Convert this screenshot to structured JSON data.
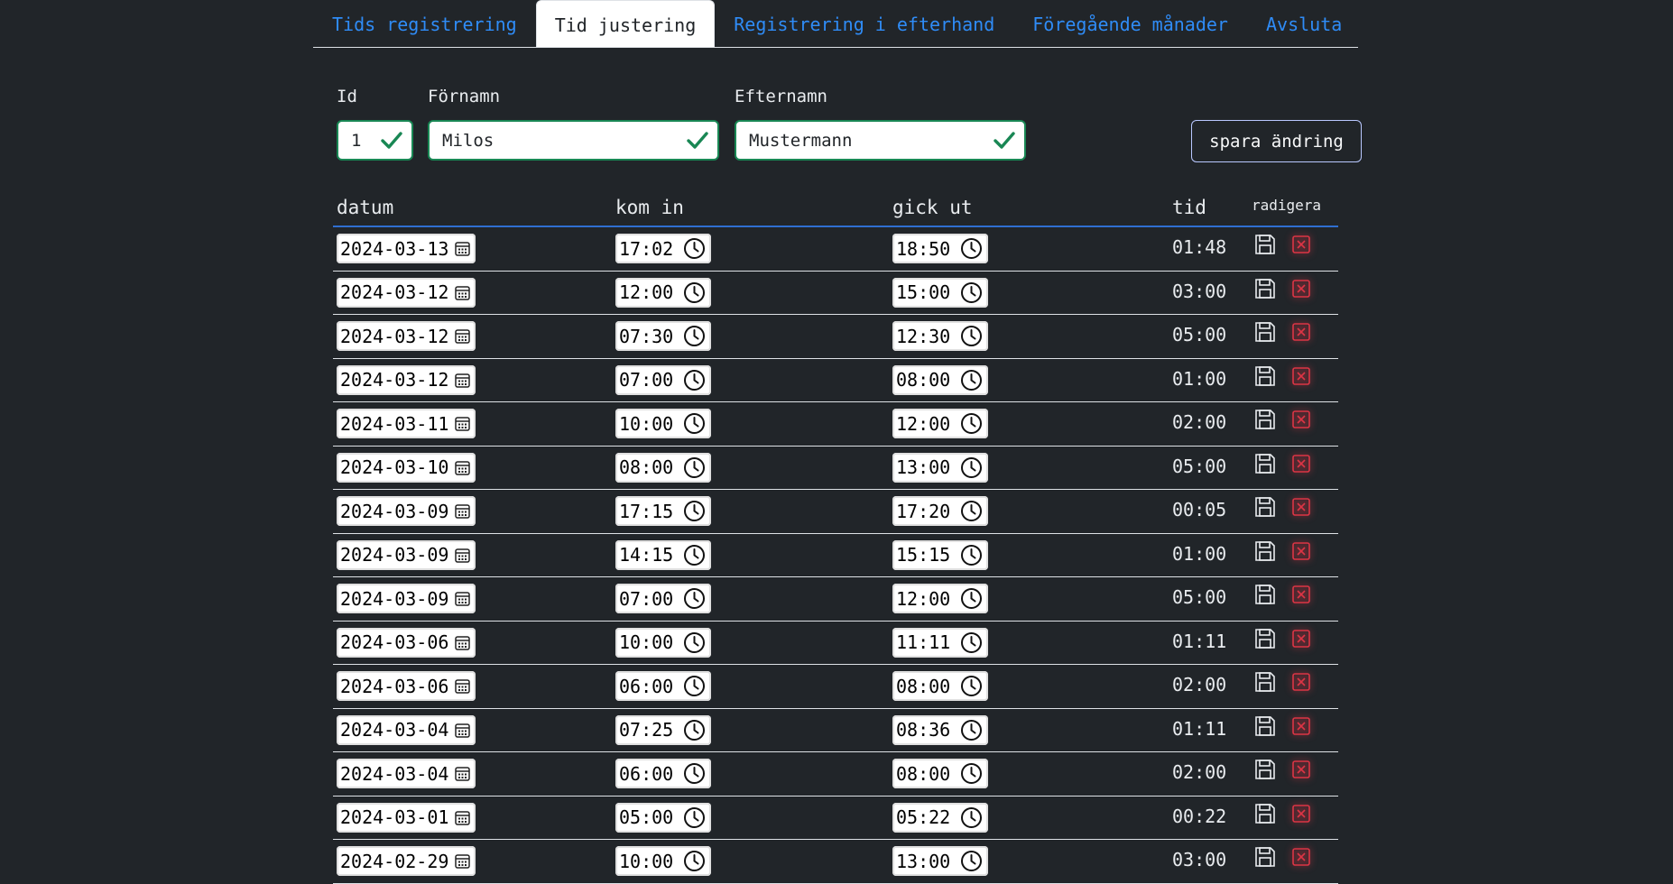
{
  "tabs": [
    {
      "label": "Tids registrering",
      "active": false
    },
    {
      "label": "Tid justering",
      "active": true
    },
    {
      "label": "Registrering i efterhand",
      "active": false
    },
    {
      "label": "Föregående månader",
      "active": false
    },
    {
      "label": "Avsluta",
      "active": false
    }
  ],
  "form": {
    "id_label": "Id",
    "id_value": "1",
    "firstname_label": "Förnamn",
    "firstname_value": "Milos",
    "lastname_label": "Efternamn",
    "lastname_value": "Mustermann",
    "save_label": "spara ändring"
  },
  "table": {
    "headers": {
      "date": "datum",
      "in": "kom in",
      "out": "gick ut",
      "time": "tid",
      "edit": "radigera"
    },
    "rows": [
      {
        "date": "2024-03-13",
        "in": "17:02",
        "out": "18:50",
        "time": "01:48"
      },
      {
        "date": "2024-03-12",
        "in": "12:00",
        "out": "15:00",
        "time": "03:00"
      },
      {
        "date": "2024-03-12",
        "in": "07:30",
        "out": "12:30",
        "time": "05:00"
      },
      {
        "date": "2024-03-12",
        "in": "07:00",
        "out": "08:00",
        "time": "01:00"
      },
      {
        "date": "2024-03-11",
        "in": "10:00",
        "out": "12:00",
        "time": "02:00"
      },
      {
        "date": "2024-03-10",
        "in": "08:00",
        "out": "13:00",
        "time": "05:00"
      },
      {
        "date": "2024-03-09",
        "in": "17:15",
        "out": "17:20",
        "time": "00:05"
      },
      {
        "date": "2024-03-09",
        "in": "14:15",
        "out": "15:15",
        "time": "01:00"
      },
      {
        "date": "2024-03-09",
        "in": "07:00",
        "out": "12:00",
        "time": "05:00"
      },
      {
        "date": "2024-03-06",
        "in": "10:00",
        "out": "11:11",
        "time": "01:11"
      },
      {
        "date": "2024-03-06",
        "in": "06:00",
        "out": "08:00",
        "time": "02:00"
      },
      {
        "date": "2024-03-04",
        "in": "07:25",
        "out": "08:36",
        "time": "01:11"
      },
      {
        "date": "2024-03-04",
        "in": "06:00",
        "out": "08:00",
        "time": "02:00"
      },
      {
        "date": "2024-03-01",
        "in": "05:00",
        "out": "05:22",
        "time": "00:22"
      },
      {
        "date": "2024-02-29",
        "in": "10:00",
        "out": "13:00",
        "time": "03:00"
      }
    ]
  },
  "colors": {
    "background": "#212529",
    "link": "#2f8cf7",
    "valid": "#198754",
    "delete": "#dc3545"
  },
  "icons": {
    "valid": "check-icon",
    "date": "calendar-icon",
    "time": "clock-icon",
    "save": "floppy-disk-icon",
    "delete": "close-box-icon"
  }
}
